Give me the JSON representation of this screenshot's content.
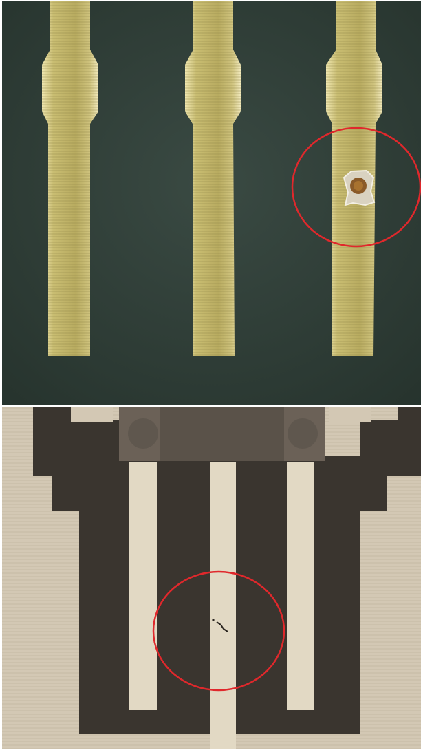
{
  "figure": {
    "panels": [
      {
        "id": "top",
        "description_hidden": "",
        "colors": {
          "substrate": "#2b3a33",
          "substrate_light": "#3a4a43",
          "trace": "#c9bd72",
          "trace_bright": "#efe6b0",
          "defect": "#8a5a28",
          "defect_ring": "#d9d2c0",
          "highlight": "#e0282c"
        },
        "icon": "defect-circle"
      },
      {
        "id": "bottom",
        "colors": {
          "base": "#d3c8b4",
          "mask": "#3a352f",
          "header": "#6b6157",
          "trace": "#e2d9c4",
          "defect": "#2a2520",
          "highlight": "#e0282c"
        },
        "icon": "defect-circle"
      }
    ]
  }
}
